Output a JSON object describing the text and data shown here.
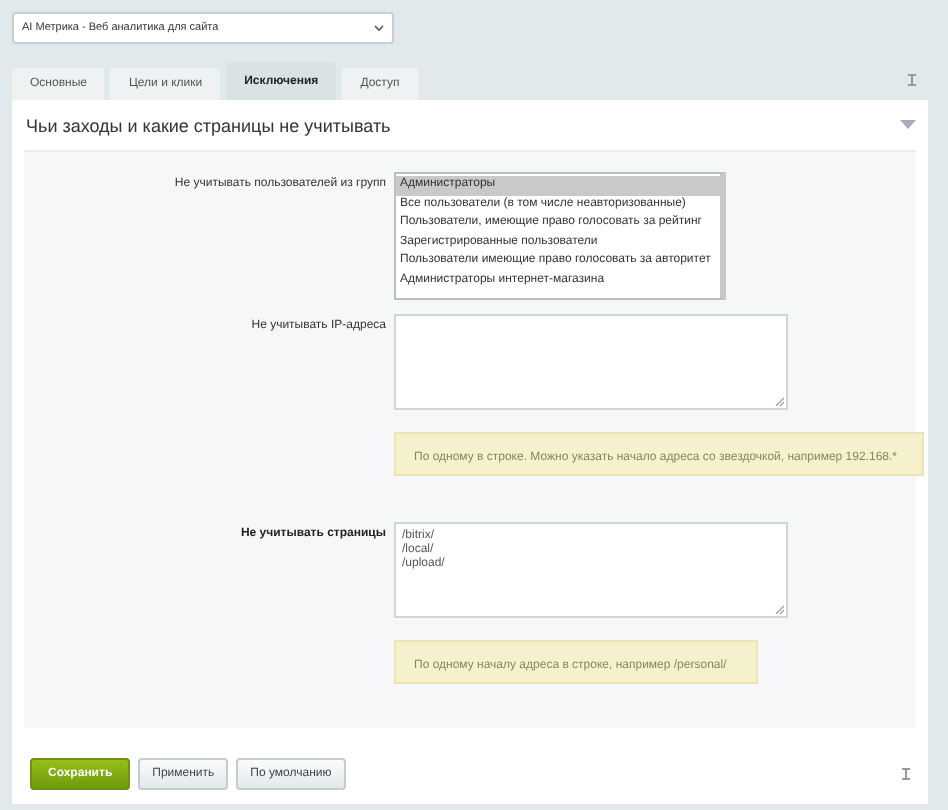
{
  "site_select": {
    "value": "AI Метрика - Веб аналитика для сайта"
  },
  "tabs": [
    {
      "label": "Основные",
      "selected": false
    },
    {
      "label": "Цели и клики",
      "selected": false
    },
    {
      "label": "Исключения",
      "selected": true
    },
    {
      "label": "Доступ",
      "selected": false
    }
  ],
  "section": {
    "title": "Чьи заходы и какие страницы не учитывать"
  },
  "fields": [
    {
      "kind": "listbox",
      "label": "Не учитывать пользователей из групп",
      "emphasized": false,
      "options": [
        {
          "label": "Администраторы",
          "selected": true
        },
        {
          "label": "Все пользователи (в том числе неавторизованные)",
          "selected": false
        },
        {
          "label": "Пользователи, имеющие право голосовать за рейтинг",
          "selected": false
        },
        {
          "label": "Зарегистрированные пользователи",
          "selected": false
        },
        {
          "label": "Пользователи имеющие право голосовать за авторитет",
          "selected": false
        },
        {
          "label": "Администраторы интернет-магазина",
          "selected": false
        }
      ]
    },
    {
      "kind": "textarea",
      "label": "Не учитывать IP-адреса",
      "emphasized": false,
      "hint": "По одному в строке. Можно указать начало адреса со звездочкой, например 192.168.*"
    },
    {
      "kind": "textarea",
      "label": "Не учитывать страницы",
      "emphasized": true,
      "lines": [
        "/bitrix/",
        "/local/",
        "/upload/"
      ],
      "hint": "По одному началу адреса в строке, например /personal/"
    }
  ],
  "buttons": [
    {
      "label": "Сохранить",
      "kind": "primary"
    },
    {
      "label": "Применить",
      "kind": "default"
    },
    {
      "label": "По умолчанию",
      "kind": "default"
    }
  ]
}
